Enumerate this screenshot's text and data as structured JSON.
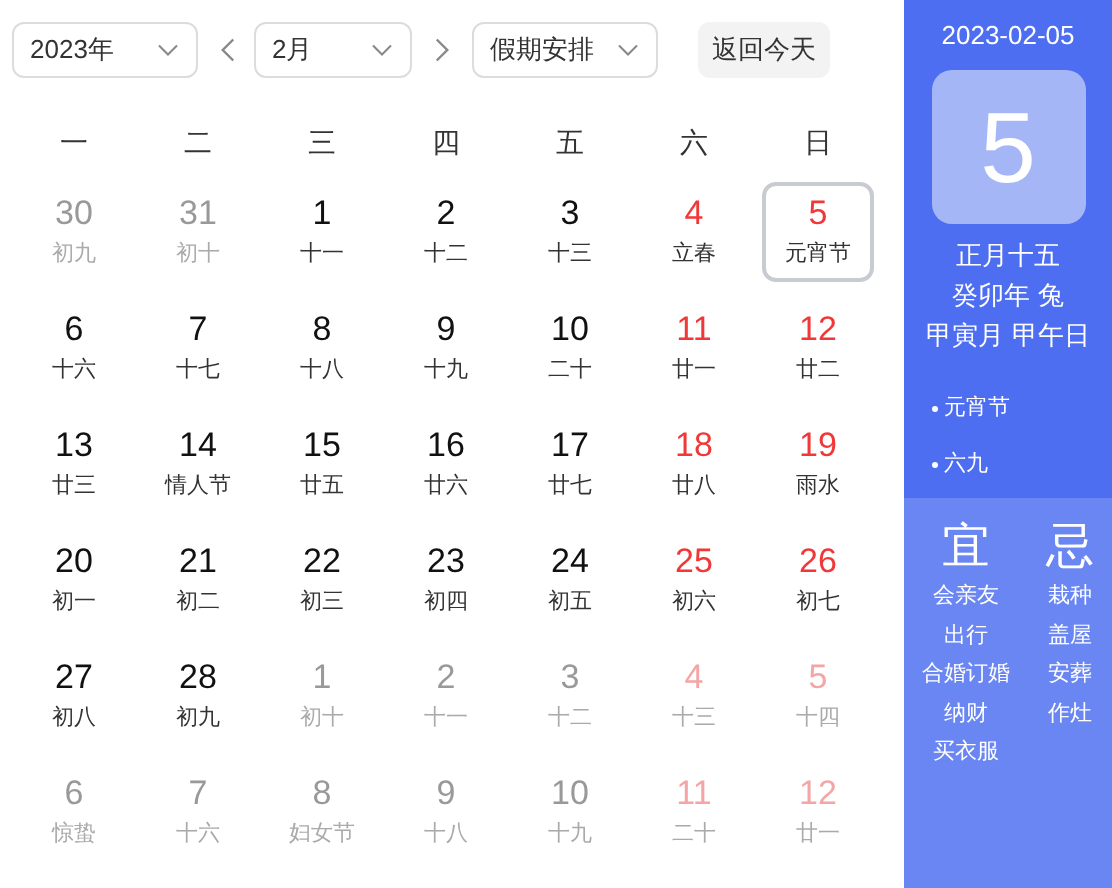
{
  "toolbar": {
    "year_select": {
      "value": "2023年"
    },
    "month_select": {
      "value": "2月"
    },
    "holiday_select": {
      "value": "假期安排"
    },
    "today_button": "返回今天"
  },
  "weekdays": [
    "一",
    "二",
    "三",
    "四",
    "五",
    "六",
    "日"
  ],
  "weeks": [
    [
      {
        "day": "30",
        "lunar": "初九",
        "other_month": true,
        "weekend": false,
        "selected": false
      },
      {
        "day": "31",
        "lunar": "初十",
        "other_month": true,
        "weekend": false,
        "selected": false
      },
      {
        "day": "1",
        "lunar": "十一",
        "other_month": false,
        "weekend": false,
        "selected": false
      },
      {
        "day": "2",
        "lunar": "十二",
        "other_month": false,
        "weekend": false,
        "selected": false
      },
      {
        "day": "3",
        "lunar": "十三",
        "other_month": false,
        "weekend": false,
        "selected": false
      },
      {
        "day": "4",
        "lunar": "立春",
        "other_month": false,
        "weekend": true,
        "selected": false
      },
      {
        "day": "5",
        "lunar": "元宵节",
        "other_month": false,
        "weekend": true,
        "selected": true
      }
    ],
    [
      {
        "day": "6",
        "lunar": "十六",
        "other_month": false,
        "weekend": false,
        "selected": false
      },
      {
        "day": "7",
        "lunar": "十七",
        "other_month": false,
        "weekend": false,
        "selected": false
      },
      {
        "day": "8",
        "lunar": "十八",
        "other_month": false,
        "weekend": false,
        "selected": false
      },
      {
        "day": "9",
        "lunar": "十九",
        "other_month": false,
        "weekend": false,
        "selected": false
      },
      {
        "day": "10",
        "lunar": "二十",
        "other_month": false,
        "weekend": false,
        "selected": false
      },
      {
        "day": "11",
        "lunar": "廿一",
        "other_month": false,
        "weekend": true,
        "selected": false
      },
      {
        "day": "12",
        "lunar": "廿二",
        "other_month": false,
        "weekend": true,
        "selected": false
      }
    ],
    [
      {
        "day": "13",
        "lunar": "廿三",
        "other_month": false,
        "weekend": false,
        "selected": false
      },
      {
        "day": "14",
        "lunar": "情人节",
        "other_month": false,
        "weekend": false,
        "selected": false
      },
      {
        "day": "15",
        "lunar": "廿五",
        "other_month": false,
        "weekend": false,
        "selected": false
      },
      {
        "day": "16",
        "lunar": "廿六",
        "other_month": false,
        "weekend": false,
        "selected": false
      },
      {
        "day": "17",
        "lunar": "廿七",
        "other_month": false,
        "weekend": false,
        "selected": false
      },
      {
        "day": "18",
        "lunar": "廿八",
        "other_month": false,
        "weekend": true,
        "selected": false
      },
      {
        "day": "19",
        "lunar": "雨水",
        "other_month": false,
        "weekend": true,
        "selected": false
      }
    ],
    [
      {
        "day": "20",
        "lunar": "初一",
        "other_month": false,
        "weekend": false,
        "selected": false
      },
      {
        "day": "21",
        "lunar": "初二",
        "other_month": false,
        "weekend": false,
        "selected": false
      },
      {
        "day": "22",
        "lunar": "初三",
        "other_month": false,
        "weekend": false,
        "selected": false
      },
      {
        "day": "23",
        "lunar": "初四",
        "other_month": false,
        "weekend": false,
        "selected": false
      },
      {
        "day": "24",
        "lunar": "初五",
        "other_month": false,
        "weekend": false,
        "selected": false
      },
      {
        "day": "25",
        "lunar": "初六",
        "other_month": false,
        "weekend": true,
        "selected": false
      },
      {
        "day": "26",
        "lunar": "初七",
        "other_month": false,
        "weekend": true,
        "selected": false
      }
    ],
    [
      {
        "day": "27",
        "lunar": "初八",
        "other_month": false,
        "weekend": false,
        "selected": false
      },
      {
        "day": "28",
        "lunar": "初九",
        "other_month": false,
        "weekend": false,
        "selected": false
      },
      {
        "day": "1",
        "lunar": "初十",
        "other_month": true,
        "weekend": false,
        "selected": false
      },
      {
        "day": "2",
        "lunar": "十一",
        "other_month": true,
        "weekend": false,
        "selected": false
      },
      {
        "day": "3",
        "lunar": "十二",
        "other_month": true,
        "weekend": false,
        "selected": false
      },
      {
        "day": "4",
        "lunar": "十三",
        "other_month": true,
        "weekend": true,
        "selected": false
      },
      {
        "day": "5",
        "lunar": "十四",
        "other_month": true,
        "weekend": true,
        "selected": false
      }
    ],
    [
      {
        "day": "6",
        "lunar": "惊蛰",
        "other_month": true,
        "weekend": false,
        "selected": false
      },
      {
        "day": "7",
        "lunar": "十六",
        "other_month": true,
        "weekend": false,
        "selected": false
      },
      {
        "day": "8",
        "lunar": "妇女节",
        "other_month": true,
        "weekend": false,
        "selected": false
      },
      {
        "day": "9",
        "lunar": "十八",
        "other_month": true,
        "weekend": false,
        "selected": false
      },
      {
        "day": "10",
        "lunar": "十九",
        "other_month": true,
        "weekend": false,
        "selected": false
      },
      {
        "day": "11",
        "lunar": "二十",
        "other_month": true,
        "weekend": true,
        "selected": false
      },
      {
        "day": "12",
        "lunar": "廿一",
        "other_month": true,
        "weekend": true,
        "selected": false
      }
    ]
  ],
  "detail": {
    "date": "2023-02-05",
    "big_day": "5",
    "lunar_lines": [
      "正月十五",
      "癸卯年 兔",
      "甲寅月 甲午日"
    ],
    "events": [
      "元宵节",
      "六九"
    ],
    "yi": {
      "title": "宜",
      "items": [
        "会亲友",
        "出行",
        "合婚订婚",
        "纳财",
        "买衣服"
      ]
    },
    "ji": {
      "title": "忌",
      "items": [
        "栽种",
        "盖屋",
        "安葬",
        "作灶"
      ]
    }
  }
}
